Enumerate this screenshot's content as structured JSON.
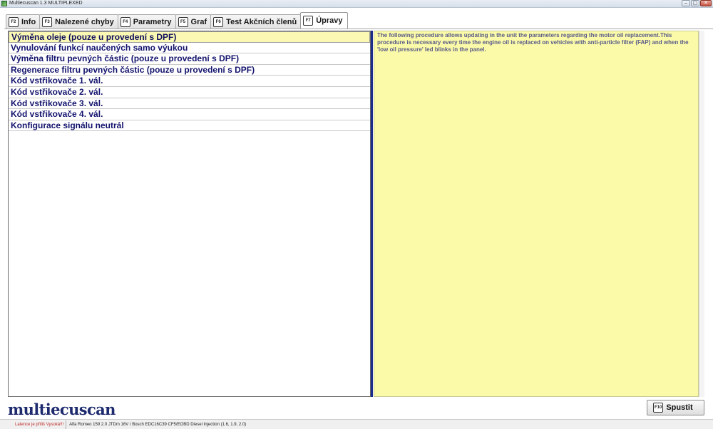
{
  "window": {
    "title": "Multiecuscan 1.3 MULTIPLEXED",
    "controls": [
      "–",
      "▢",
      "✕"
    ]
  },
  "tabs": [
    {
      "key": "F2",
      "label": "Info"
    },
    {
      "key": "F3",
      "label": "Nalezené chyby"
    },
    {
      "key": "F4",
      "label": "Parametry"
    },
    {
      "key": "F5",
      "label": "Graf"
    },
    {
      "key": "F6",
      "label": "Test Akčních členů"
    },
    {
      "key": "F7",
      "label": "Úpravy",
      "active": true
    }
  ],
  "procedures": {
    "items": [
      "Výměna oleje (pouze u provedení s DPF)",
      "Vynulování funkcí naučených samo výukou",
      "Výměna filtru pevných částic (pouze u provedení s DPF)",
      "Regenerace filtru pevných částic (pouze u provedení s DPF)",
      "Kód vstřikovače 1. vál.",
      "Kód vstřikovače 2. vál.",
      "Kód vstřikovače 3. vál.",
      "Kód vstřikovače 4. vál.",
      "Konfigurace signálu neutrál"
    ],
    "selected_index": 0
  },
  "description": {
    "text": "The following procedure allows updating in the unit the parameters regarding the motor oil replacement.This procedure is necessary every time the engine oil is replaced on vehicles with anti-particle filter (FAP) and when the 'low oil pressure' led blinks in the panel."
  },
  "footer": {
    "logo": "multiecuscan",
    "run_key": "F10",
    "run_label": "Spustit"
  },
  "statusbar": {
    "warning": "Latence je příliš Vysoká!!!",
    "vehicle": "Alfa Romeo 159 2.0 JTDm 16V / Bosch EDC16C39 CF5/EOBD Diesel Injection (1.6, 1.9, 2.0)"
  },
  "colors": {
    "selected_row": "#fbf8b4",
    "description_bg": "#fafaa8",
    "list_text": "#13136e",
    "warning_text": "#c0282a"
  }
}
